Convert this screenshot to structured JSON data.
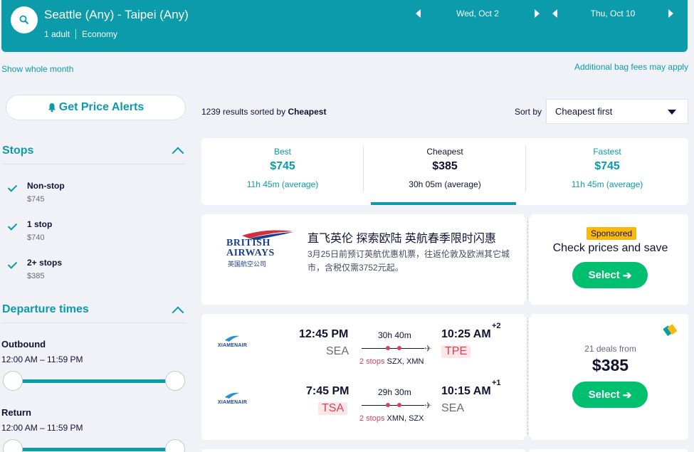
{
  "header": {
    "route": "Seattle (Any) - Taipei (Any)",
    "passengers": "1 adult",
    "cabin": "Economy",
    "depart_date": "Wed, Oct 2",
    "return_date": "Thu, Oct 10"
  },
  "links": {
    "show_whole_month": "Show whole month",
    "bag_fees": "Additional bag fees may apply"
  },
  "sidebar": {
    "price_alerts": "Get Price Alerts",
    "stops_title": "Stops",
    "stops": [
      {
        "label": "Non-stop",
        "price": "$745",
        "checked": true
      },
      {
        "label": "1 stop",
        "price": "$740",
        "checked": true
      },
      {
        "label": "2+ stops",
        "price": "$385",
        "checked": true
      }
    ],
    "departure_title": "Departure times",
    "outbound_label": "Outbound",
    "outbound_range": "12:00 AM – 11:59 PM",
    "return_label": "Return",
    "return_range": "12:00 AM – 11:59 PM"
  },
  "results": {
    "count": "1239",
    "sorted_by_text": "results sorted by",
    "sorted_by": "Cheapest",
    "sort_label": "Sort by",
    "sort_value": "Cheapest first"
  },
  "sort_tabs": [
    {
      "name": "Best",
      "price": "$745",
      "duration": "11h 45m (average)",
      "active": false
    },
    {
      "name": "Cheapest",
      "price": "$385",
      "duration": "30h 05m (average)",
      "active": true
    },
    {
      "name": "Fastest",
      "price": "$745",
      "duration": "11h 45m (average)",
      "active": false
    }
  ],
  "ad": {
    "brand_line1": "BRITISH",
    "brand_line2": "AIRWAYS",
    "brand_cn": "英国航空公司",
    "title": "直飞英伦 探索欧陆 英航春季限时闪惠",
    "description": "3月25日前预订英航优惠机票，往返伦敦及欧洲其它城市，含税仅需3752元起。",
    "sponsored": "Sponsored",
    "cta_text": "Check prices and save",
    "select": "Select"
  },
  "flight": {
    "airline_text": "XIAMENAIR",
    "deals": "21 deals from",
    "price": "$385",
    "select": "Select",
    "legs": [
      {
        "depart_time": "12:45 PM",
        "depart_airport": "SEA",
        "duration": "30h 40m",
        "stops_count": "2 stops",
        "stops_via": "SZX, XMN",
        "arrive_time": "10:25 AM",
        "day_offset": "+2",
        "arrive_airport": "TPE"
      },
      {
        "depart_time": "7:45 PM",
        "depart_airport": "TSA",
        "duration": "29h 30m",
        "stops_count": "2 stops",
        "stops_via": "XMN, SZX",
        "arrive_time": "10:15 AM",
        "day_offset": "+1",
        "arrive_airport": "SEA"
      }
    ]
  },
  "colors": {
    "brand": "#0b9bab",
    "select_green": "#00bf6f",
    "stop_red": "#d1435b",
    "sponsored_yellow": "#f9b80e"
  }
}
